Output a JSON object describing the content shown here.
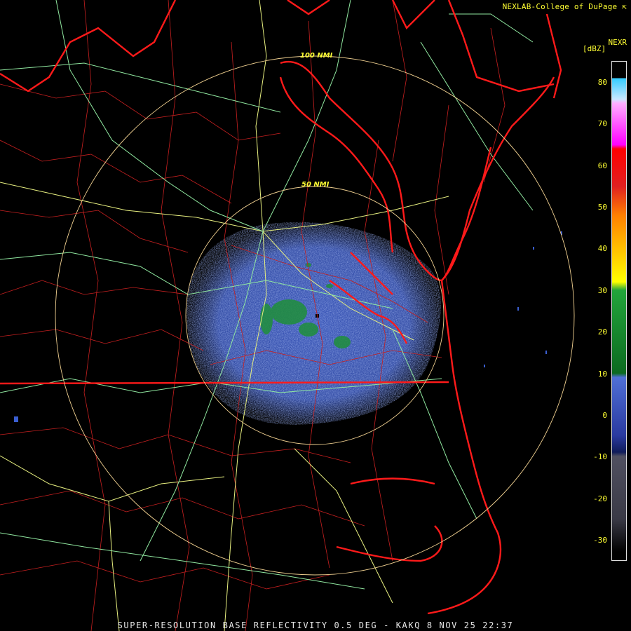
{
  "title": "SUPER-RESOLUTION BASE REFLECTIVITY 0.5 DEG - KAKQ 8 NOV 25 22:37",
  "credit": "NEXLAB-College of DuPage",
  "range_rings": [
    {
      "label": "50 NMI"
    },
    {
      "label": "100 NMI"
    }
  ],
  "legend": {
    "product": "NEXR",
    "unit": "[dBZ]",
    "ticks": [
      "80",
      "70",
      "60",
      "50",
      "40",
      "30",
      "20",
      "10",
      "0",
      "-10",
      "-20",
      "-30"
    ],
    "colors": {
      "below_minus10": "#505060",
      "zero_band": "#2a3aa0",
      "light_blue": "#4f6fd6",
      "green": "#22a53b",
      "yellow": "#ffff00",
      "orange": "#ff8000",
      "red": "#ff0000",
      "magenta": "#ff00ff",
      "cyan": "#33ccff"
    }
  },
  "map_colors": {
    "state_border": "#ff1a1a",
    "county_border": "#cc2222",
    "highway_primary": "#e8f080",
    "highway_secondary": "#90e8a0",
    "range_ring": "#f0d090",
    "echo_main": "#4a64c8"
  }
}
